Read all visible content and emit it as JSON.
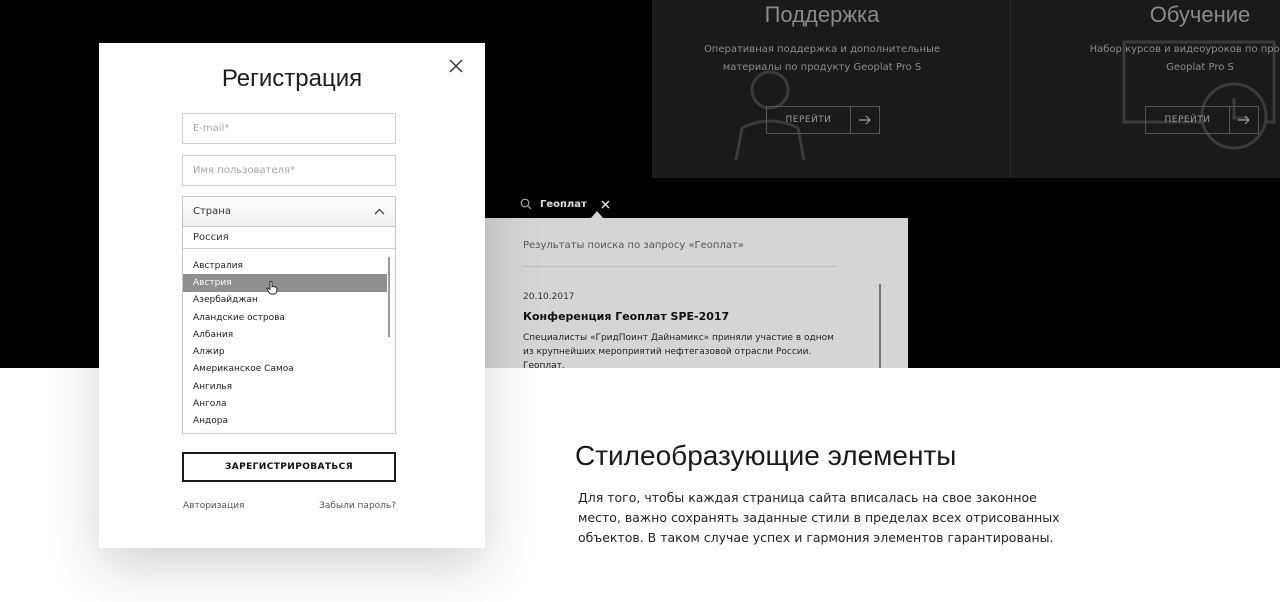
{
  "services": {
    "support": {
      "title": "Поддержка",
      "description": "Оперативная поддержка и дополнительные материалы по продукту Geoplat Pro S",
      "button_label": "ПЕРЕЙТИ"
    },
    "learning": {
      "title": "Обучение",
      "description": "Набор курсов и видеоуроков по продукту Geoplat Pro S",
      "button_label": "ПЕРЕЙТИ"
    }
  },
  "search": {
    "query": "Геоплат",
    "results_heading": "Результаты поиска по запросу «Геоплат»",
    "result": {
      "date": "20.10.2017",
      "title": "Конференция Геоплат SPE-2017",
      "description": "Специалисты «ГридПоинт Дайнамикс» приняли участие в одном из крупнейших мероприятий нефтегазовой отрасли России. Геоплат."
    }
  },
  "registration": {
    "title": "Регистрация",
    "email_placeholder": "E-mail*",
    "username_placeholder": "Имя пользователя*",
    "country_label": "Страна",
    "country_search_value": "Россия",
    "country_options": [
      "Австралия",
      "Австрия",
      "Азербайджан",
      "Аландские острова",
      "Албания",
      "Алжир",
      "Американское Самоа",
      "Ангилья",
      "Ангола",
      "Андора"
    ],
    "selected_option": "Австрия",
    "submit_label": "ЗАРЕГИСТРИРОВАТЬСЯ",
    "auth_link": "Авторизация",
    "forgot_link": "Забыли пароль?"
  },
  "section": {
    "title": "Стилеобразующие элементы",
    "body": "Для того, чтобы каждая страница сайта вписалась на свое законное место, важно сохранять заданные стили в пределах всех отрисованных объектов. В таком случае успех и гармония элементов гарантированы."
  },
  "colors": {
    "dark_band": "#000000",
    "panel": "#1a1a1a",
    "search_results_bg": "#d5d5d5",
    "selected_option": "#8f8f8f"
  }
}
